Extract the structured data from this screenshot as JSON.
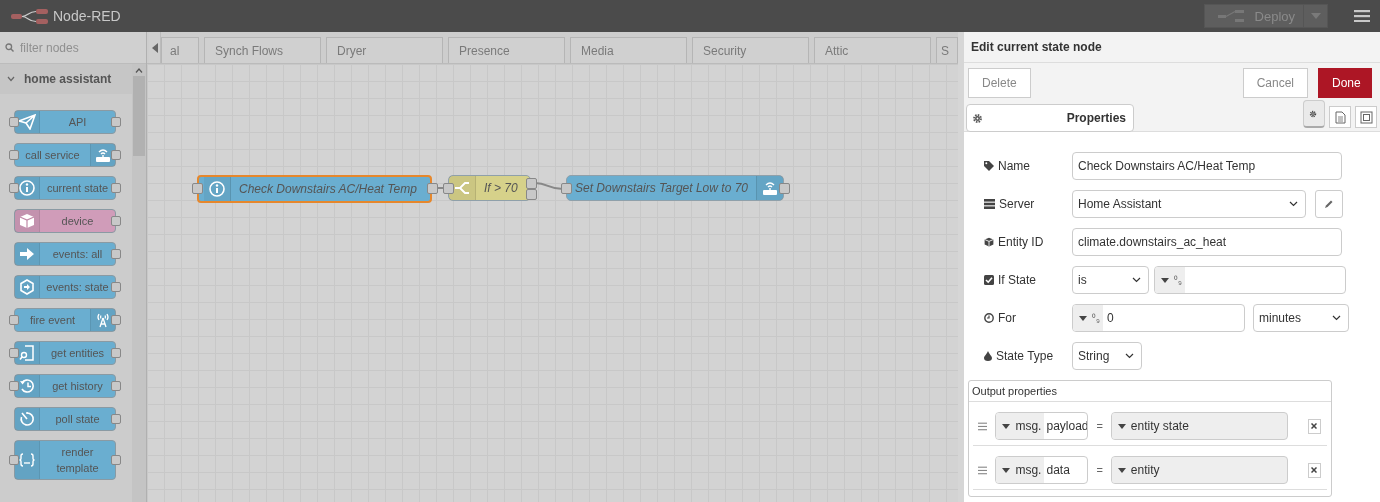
{
  "header": {
    "title": "Node-RED",
    "deploy": {
      "label": "Deploy",
      "disabled": true
    }
  },
  "palette": {
    "search": {
      "placeholder": "filter nodes"
    },
    "categories": [
      {
        "name": "home assistant",
        "expanded": true,
        "nodes": [
          {
            "label": "API",
            "color": "#6aaed0",
            "kind": "standard",
            "input": true,
            "output": true
          },
          {
            "label": "call service",
            "color": "#6aaed0",
            "kind": "action",
            "input": true,
            "output": true
          },
          {
            "label": "current state",
            "color": "#6aaed0",
            "kind": "standard",
            "input": true,
            "output": true
          },
          {
            "label": "device",
            "color": "#d09cb9",
            "kind": "standard",
            "input": false,
            "output": true
          },
          {
            "label": "events: all",
            "color": "#6aaed0",
            "kind": "standard",
            "input": false,
            "output": true
          },
          {
            "label": "events: state",
            "color": "#6aaed0",
            "kind": "standard",
            "input": false,
            "output": true
          },
          {
            "label": "fire event",
            "color": "#6aaed0",
            "kind": "action",
            "input": true,
            "output": true
          },
          {
            "label": "get entities",
            "color": "#6aaed0",
            "kind": "standard",
            "input": true,
            "output": true
          },
          {
            "label": "get history",
            "color": "#6aaed0",
            "kind": "standard",
            "input": true,
            "output": true
          },
          {
            "label": "poll state",
            "color": "#6aaed0",
            "kind": "standard",
            "input": false,
            "output": true
          },
          {
            "label": "render template",
            "color": "#6aaed0",
            "kind": "standard",
            "input": true,
            "output": true
          }
        ]
      }
    ]
  },
  "workspace": {
    "tabs": [
      {
        "label": "al",
        "selected": false
      },
      {
        "label": "Synch Flows",
        "selected": false
      },
      {
        "label": "Dryer",
        "selected": false
      },
      {
        "label": "Presence",
        "selected": false
      },
      {
        "label": "Media",
        "selected": false
      },
      {
        "label": "Security",
        "selected": false
      },
      {
        "label": "Attic",
        "selected": false
      },
      {
        "label": "S",
        "selected": false
      }
    ],
    "nodes": [
      {
        "kind": "state",
        "label": "Check Downstairs AC/Heat Temp",
        "color": "#6aaed0",
        "selected": true
      },
      {
        "kind": "switch",
        "label": "If > 70",
        "color": "#d6d18a",
        "selected": false
      },
      {
        "kind": "service",
        "label": "Set Downstairs Target Low to 70",
        "color": "#6aaed0",
        "selected": false
      }
    ]
  },
  "tray": {
    "title": "Edit current state node",
    "buttons": {
      "delete": "Delete",
      "cancel": "Cancel",
      "done": "Done"
    },
    "tabs": [
      {
        "label": "Properties",
        "selected": true
      }
    ],
    "tool_buttons": [
      {
        "kind": "gear",
        "selected": true
      },
      {
        "kind": "document",
        "selected": false
      },
      {
        "kind": "frame",
        "selected": false
      }
    ],
    "form": {
      "name": {
        "label": "Name",
        "value": "Check Downstairs AC/Heat Temp"
      },
      "server": {
        "label": "Server",
        "value": "Home Assistant"
      },
      "entity_id": {
        "label": "Entity ID",
        "value": "climate.downstairs_ac_heat"
      },
      "if_state": {
        "label": "If State",
        "checked": true,
        "operator": "is",
        "type_mark": "⁰₉"
      },
      "for": {
        "label": "For",
        "type_mark": "⁰₉",
        "value": "0",
        "unit": "minutes"
      },
      "state_type": {
        "label": "State Type",
        "value": "String"
      },
      "output_properties": {
        "title": "Output properties",
        "rows": [
          {
            "prefix": "msg.",
            "property": "payload",
            "equals": "=",
            "value": "entity state"
          },
          {
            "prefix": "msg.",
            "property": "data",
            "equals": "=",
            "value": "entity"
          }
        ]
      }
    }
  }
}
